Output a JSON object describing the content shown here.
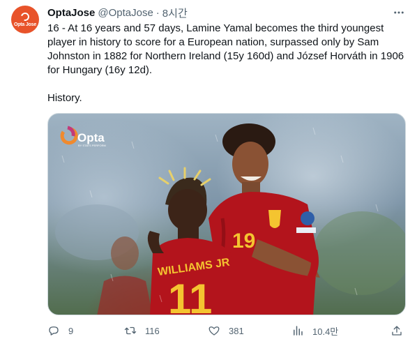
{
  "author": {
    "display_name": "OptaJose",
    "handle": "@OptaJose",
    "separator": "·",
    "time": "8시간",
    "avatar_text": "Opta Jose",
    "avatar_color": "#e8532a"
  },
  "tweet": {
    "paragraphs": [
      "16 - At 16 years and 57 days, Lamine Yamal becomes the third youngest player in history to score for a European nation, surpassed only by Sam Johnston in 1882 for Northern Ireland (15y 160d) and József Horváth in 1906 for Hungary (16y 12d).",
      "History."
    ]
  },
  "media": {
    "logo_text": "Opta",
    "logo_subtext": "BY STATS PERFORM",
    "shirt_name": "WILLIAMS JR",
    "shirt_number": "11",
    "front_number": "19"
  },
  "actions": {
    "replies": "9",
    "retweets": "116",
    "likes": "381",
    "views": "10.4만"
  },
  "icons": {
    "more": "more-icon",
    "reply": "reply-icon",
    "retweet": "retweet-icon",
    "like": "heart-icon",
    "views": "views-icon",
    "share": "share-icon"
  },
  "colors": {
    "text": "#0f1419",
    "secondary": "#536471",
    "border": "#cfd9de",
    "spain_red": "#b3141c",
    "gold": "#f4c430"
  }
}
